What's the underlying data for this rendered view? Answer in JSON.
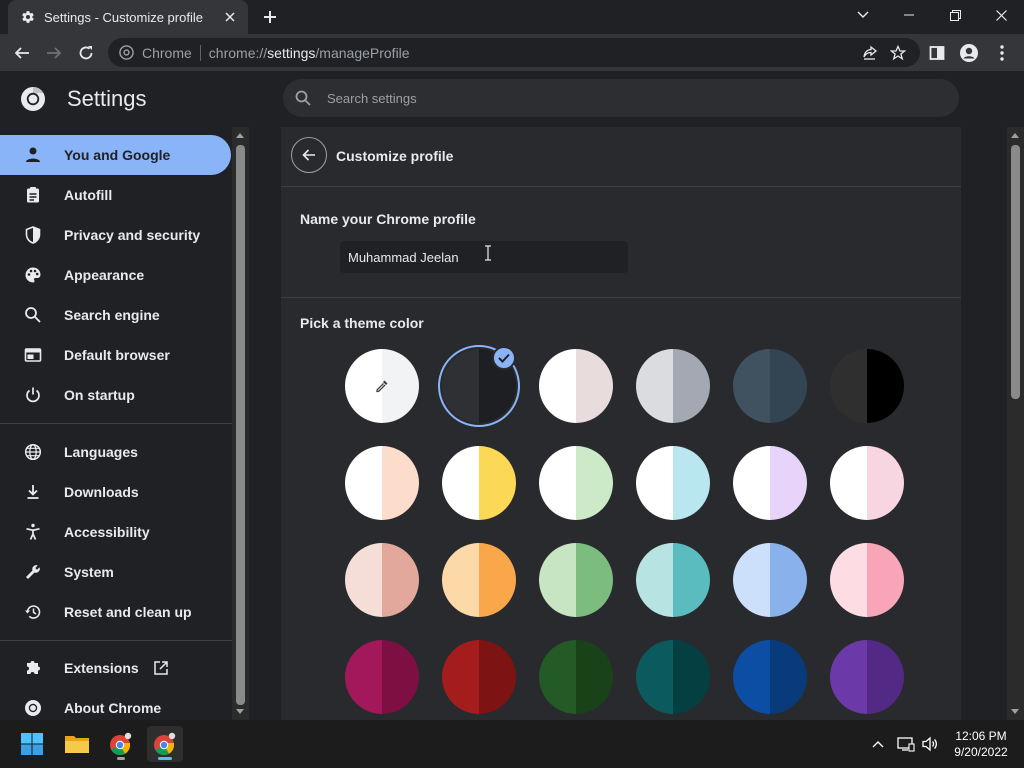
{
  "tab": {
    "title": "Settings - Customize profile"
  },
  "omnibox": {
    "site_name": "Chrome",
    "url_scheme": "chrome://",
    "url_host": "settings",
    "url_path": "/manageProfile"
  },
  "header": {
    "title": "Settings",
    "search_placeholder": "Search settings"
  },
  "sidebar": {
    "items": [
      {
        "label": "You and Google",
        "icon": "person-icon",
        "active": true
      },
      {
        "label": "Autofill",
        "icon": "clipboard-icon"
      },
      {
        "label": "Privacy and security",
        "icon": "shield-icon"
      },
      {
        "label": "Appearance",
        "icon": "palette-icon"
      },
      {
        "label": "Search engine",
        "icon": "search-icon"
      },
      {
        "label": "Default browser",
        "icon": "browser-window-icon"
      },
      {
        "label": "On startup",
        "icon": "power-icon"
      },
      {
        "label": "Languages",
        "icon": "globe-icon"
      },
      {
        "label": "Downloads",
        "icon": "download-icon"
      },
      {
        "label": "Accessibility",
        "icon": "accessibility-icon"
      },
      {
        "label": "System",
        "icon": "wrench-icon"
      },
      {
        "label": "Reset and clean up",
        "icon": "history-icon"
      },
      {
        "label": "Extensions",
        "icon": "puzzle-icon"
      },
      {
        "label": "About Chrome",
        "icon": "chrome-icon"
      }
    ]
  },
  "profile": {
    "title": "Customize profile",
    "name_label": "Name your Chrome profile",
    "name_value": "Muhammad Jeelan",
    "theme_label": "Pick a theme color"
  },
  "themes": [
    {
      "left": "#ffffff",
      "right": "#f1f3f4",
      "type": "picker"
    },
    {
      "left": "#2f3033",
      "right": "#1e1f22",
      "selected": true
    },
    {
      "left": "#ffffff",
      "right": "#e8dcdc"
    },
    {
      "left": "#dadce0",
      "right": "#a3a8b2"
    },
    {
      "left": "#40525f",
      "right": "#334552"
    },
    {
      "left": "#2f2f2f",
      "right": "#000000"
    },
    {
      "left": "#ffffff",
      "right": "#fcdcca"
    },
    {
      "left": "#ffffff",
      "right": "#fcd857"
    },
    {
      "left": "#ffffff",
      "right": "#cdeac8"
    },
    {
      "left": "#ffffff",
      "right": "#b9e6ef"
    },
    {
      "left": "#ffffff",
      "right": "#e8d4fb"
    },
    {
      "left": "#ffffff",
      "right": "#f7d6e2"
    },
    {
      "left": "#f5ddd8",
      "right": "#e2a89b"
    },
    {
      "left": "#fdd9a8",
      "right": "#faa64a"
    },
    {
      "left": "#c7e5c3",
      "right": "#7cbd7f"
    },
    {
      "left": "#b8e3e3",
      "right": "#5bbcc0"
    },
    {
      "left": "#cde0fb",
      "right": "#89b2ec"
    },
    {
      "left": "#fddde3",
      "right": "#f8a6b7"
    },
    {
      "left": "#a3185a",
      "right": "#7d0f43"
    },
    {
      "left": "#a41c1c",
      "right": "#7e1313"
    },
    {
      "left": "#245a26",
      "right": "#1a4219"
    },
    {
      "left": "#0b5b5e",
      "right": "#063f42"
    },
    {
      "left": "#0b4ea3",
      "right": "#083b7a"
    },
    {
      "left": "#6b3aa8",
      "right": "#522a86"
    }
  ],
  "taskbar": {
    "time": "12:06 PM",
    "date": "9/20/2022",
    "apps": [
      "windows-start-icon",
      "file-explorer-icon",
      "chrome-icon",
      "chrome-icon"
    ]
  }
}
